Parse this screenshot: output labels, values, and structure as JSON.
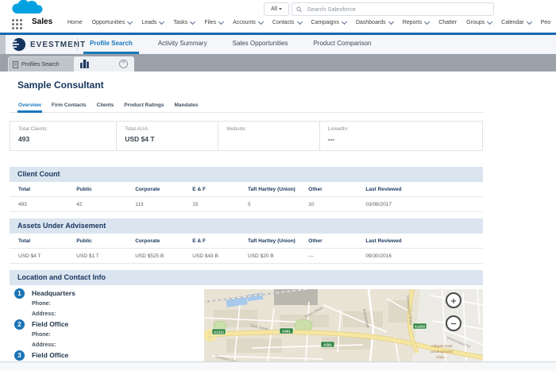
{
  "colors": {
    "accent_blue": "#1878be",
    "navy": "#17365d",
    "nav_border_blue": "#1467b2",
    "section_bar_bg": "#dbe5f0",
    "tabstrip_bg": "#9aa1a9",
    "brand_cloud": "#00a1e0",
    "location_badge": "#1c74b4"
  },
  "topnav": {
    "app_name": "Sales",
    "items": [
      {
        "label": "Home",
        "chevron": false
      },
      {
        "label": "Opportunities",
        "chevron": true
      },
      {
        "label": "Leads",
        "chevron": true
      },
      {
        "label": "Tasks",
        "chevron": true
      },
      {
        "label": "Files",
        "chevron": true
      },
      {
        "label": "Accounts",
        "chevron": true
      },
      {
        "label": "Contacts",
        "chevron": true
      },
      {
        "label": "Campaigns",
        "chevron": true
      },
      {
        "label": "Dashboards",
        "chevron": true
      },
      {
        "label": "Reports",
        "chevron": true
      },
      {
        "label": "Chatter",
        "chevron": false
      },
      {
        "label": "Groups",
        "chevron": true
      },
      {
        "label": "Calendar",
        "chevron": true
      },
      {
        "label": "Peo",
        "chevron": false
      }
    ],
    "search": {
      "scope": "All",
      "placeholder": "Search Salesforce"
    }
  },
  "subnav": {
    "brand": "EVESTMENT",
    "tabs": [
      {
        "label": "Profile Search",
        "active": true
      },
      {
        "label": "Activity Summary",
        "active": false
      },
      {
        "label": "Sales Opportunities",
        "active": false
      },
      {
        "label": "Product Comparison",
        "active": false
      }
    ]
  },
  "tabstrip": {
    "profiles_tab": "Profiles Search"
  },
  "page": {
    "title": "Sample Consultant",
    "tabs": [
      {
        "label": "Overview",
        "active": true
      },
      {
        "label": "Firm Contacts",
        "active": false
      },
      {
        "label": "Clients",
        "active": false
      },
      {
        "label": "Product Ratings",
        "active": false
      },
      {
        "label": "Mandates",
        "active": false
      }
    ],
    "summary": [
      {
        "label": "Total Clients:",
        "value": "493"
      },
      {
        "label": "Total AUA:",
        "value": "USD $4 T"
      },
      {
        "label": "Website:",
        "value": ""
      },
      {
        "label": "LinkedIn:",
        "value": "---"
      }
    ],
    "sections": [
      {
        "title": "Client Count",
        "columns": [
          "Total",
          "Public",
          "Corporate",
          "E & F",
          "Taft Hartley (Union)",
          "Other",
          "Last Reviewed"
        ],
        "row": [
          "493",
          "42",
          "113",
          "15",
          "5",
          "10",
          "03/08/2017"
        ]
      },
      {
        "title": "Assets Under Advisement",
        "columns": [
          "Total",
          "Public",
          "Corporate",
          "E & F",
          "Taft Hartley (Union)",
          "Other",
          "Last Reviewed"
        ],
        "row": [
          "USD $4 T",
          "USD $1 T",
          "USD $525 B",
          "USD $43 B",
          "USD $20 B",
          "---",
          "09/30/2016"
        ]
      }
    ],
    "locations": {
      "title": "Location and Contact Info",
      "items": [
        {
          "num": "1",
          "name": "Headquarters",
          "fields": [
            "Phone:",
            "Address:"
          ]
        },
        {
          "num": "2",
          "name": "Field Office",
          "fields": [
            "Phone:",
            "Address:"
          ]
        },
        {
          "num": "3",
          "name": "Field Office",
          "fields": []
        }
      ]
    }
  },
  "map": {
    "road_badges": [
      "A1211",
      "A501",
      "A501",
      "A1202"
    ],
    "street_labels": [
      "Fore Street",
      "Eldon Street",
      "Gresham Street",
      "Bishopsgate",
      "Commercial Street",
      "Whitechapel Rd"
    ],
    "station_lines": [
      "Aldgate East",
      "Underground",
      "Stati..."
    ],
    "zoom_in": "+",
    "zoom_out": "−"
  }
}
